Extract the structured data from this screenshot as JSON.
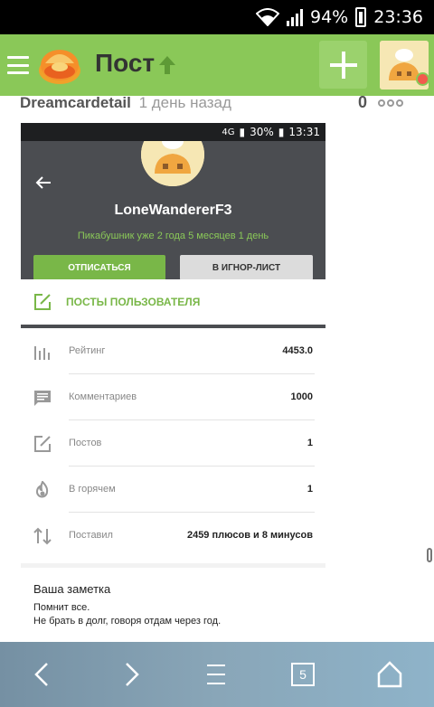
{
  "status_bar": {
    "battery_percent": "94%",
    "time": "23:36"
  },
  "header": {
    "title": "Пост",
    "icons": [
      "menu-icon",
      "pikabu-logo",
      "arrow-up-icon",
      "plus-icon",
      "user-avatar"
    ],
    "accent_color": "#8ac858"
  },
  "post": {
    "author": "Dreamcardetail",
    "time_ago": "1 день назад",
    "rating": "0"
  },
  "screenshot": {
    "status": {
      "network": "4G",
      "battery": "30%",
      "time": "13:31"
    },
    "profile": {
      "username": "LoneWandererF3",
      "since": "Пикабушник уже 2 года 5 месяцев 1 день",
      "unsubscribe_label": "ОТПИСАТЬСЯ",
      "ignore_label": "В ИГНОР-ЛИСТ",
      "posts_link_label": "ПОСТЫ ПОЛЬЗОВАТЕЛЯ"
    },
    "stats": [
      {
        "icon": "bar-chart-icon",
        "label": "Рейтинг",
        "value": "4453.0"
      },
      {
        "icon": "comment-icon",
        "label": "Комментариев",
        "value": "1000"
      },
      {
        "icon": "edit-icon",
        "label": "Постов",
        "value": "1"
      },
      {
        "icon": "flame-icon",
        "label": "В горячем",
        "value": "1"
      },
      {
        "icon": "up-down-arrows-icon",
        "label": "Поставил",
        "value": "2459 плюсов и 8 минусов"
      }
    ],
    "note": {
      "title": "Ваша заметка",
      "line1": "Помнит все.",
      "line2": "Не брать в долг, говоря отдам через год."
    }
  },
  "bottom_nav": {
    "tabs_count": "5",
    "icons": [
      "back-icon",
      "forward-icon",
      "menu-icon",
      "tabs-icon",
      "home-icon"
    ]
  }
}
